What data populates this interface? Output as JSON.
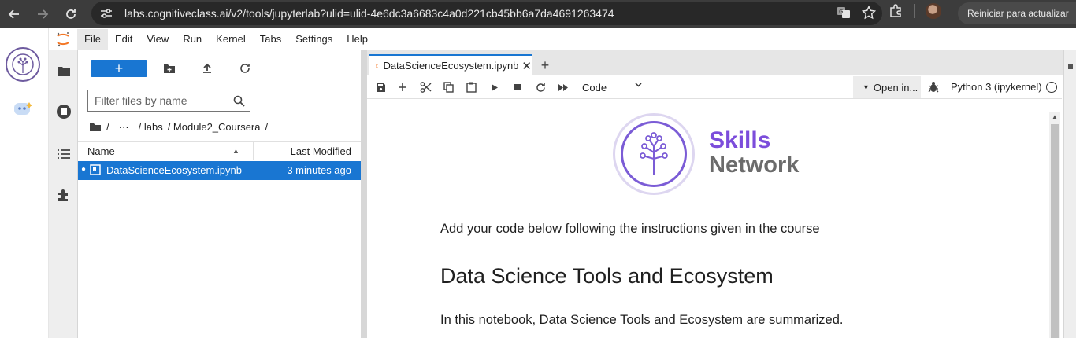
{
  "browser": {
    "url": "labs.cognitiveclass.ai/v2/tools/jupyterlab?ulid=ulid-4e6dc3a6683c4a0d221cb45bb6a7da4691263474",
    "update_button": "Reiniciar para actualizar"
  },
  "menubar": {
    "items": [
      "File",
      "Edit",
      "View",
      "Run",
      "Kernel",
      "Tabs",
      "Settings",
      "Help"
    ],
    "active": "File"
  },
  "filebrowser": {
    "new_button_label": "+",
    "filter_placeholder": "Filter files by name",
    "breadcrumbs": [
      "/",
      "···",
      "/ labs",
      "/ Module2_Coursera",
      "/"
    ],
    "columns": {
      "name": "Name",
      "modified": "Last Modified"
    },
    "files": [
      {
        "name": "DataScienceEcosystem.ipynb",
        "modified": "3 minutes ago",
        "selected": true
      }
    ]
  },
  "notebook": {
    "tab_title": "DataScienceEcosystem.ipynb",
    "cell_type": "Code",
    "open_in": "Open in...",
    "kernel": "Python 3 (ipykernel)",
    "logo": {
      "line1": "Skills",
      "line2": "Network"
    },
    "intro_text": "Add your code below following the instructions given in the course",
    "heading": "Data Science Tools and Ecosystem",
    "paragraph": "In this notebook, Data Science Tools and Ecosystem are summarized."
  },
  "colors": {
    "accent": "#1976d2",
    "skills_purple": "#7c4ddb",
    "network_gray": "#6b6b6b"
  },
  "icons": {
    "browser": [
      "back-icon",
      "forward-icon",
      "reload-icon",
      "site-settings-icon",
      "translate-icon",
      "star-icon",
      "extensions-icon"
    ],
    "left_tabs": [
      "folder-icon",
      "running-icon",
      "toc-icon",
      "extension-icon"
    ],
    "file_toolbar": [
      "new-folder-icon",
      "upload-icon",
      "refresh-icon"
    ],
    "notebook_toolbar": [
      "save-icon",
      "add-cell-icon",
      "cut-icon",
      "copy-icon",
      "paste-icon",
      "run-icon",
      "stop-icon",
      "restart-icon",
      "fast-forward-icon",
      "debugger-icon"
    ]
  }
}
